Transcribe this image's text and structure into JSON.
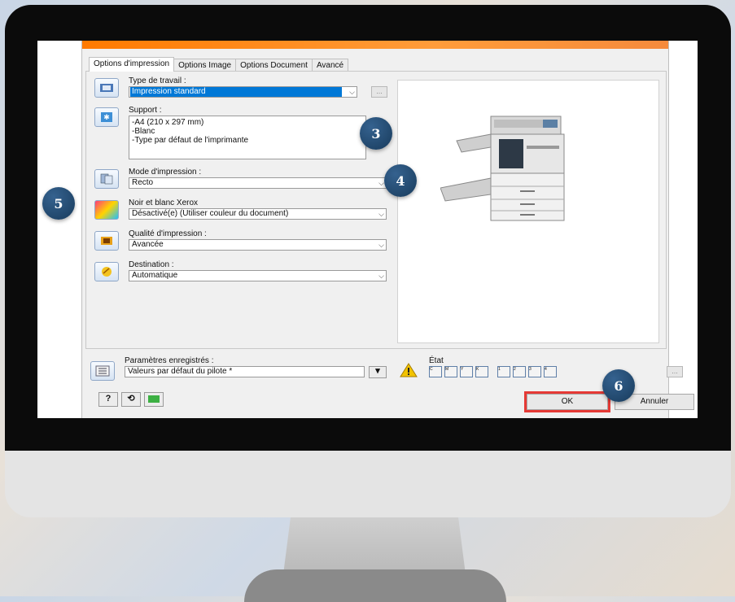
{
  "tabs": [
    "Options d'impression",
    "Options Image",
    "Options Document",
    "Avancé"
  ],
  "type_travail": {
    "label": "Type de travail :",
    "value": "Impression standard"
  },
  "support": {
    "label": "Support :",
    "lines": [
      "-A4 (210 x 297 mm)",
      "-Blanc",
      "-Type par défaut de l'imprimante"
    ]
  },
  "mode": {
    "label": "Mode d'impression :",
    "value": "Recto"
  },
  "noir_blanc": {
    "label": "Noir et blanc Xerox",
    "value": "Désactivé(e) (Utiliser couleur du document)"
  },
  "qualite": {
    "label": "Qualité d'impression :",
    "value": "Avancée"
  },
  "destination": {
    "label": "Destination :",
    "value": "Automatique"
  },
  "params": {
    "label": "Paramètres enregistrés :",
    "value": "Valeurs par défaut du pilote *"
  },
  "etat": {
    "label": "État :",
    "cells": [
      "C",
      "M",
      "Y",
      "K",
      "1",
      "2",
      "3",
      "4"
    ]
  },
  "buttons": {
    "ok": "OK",
    "cancel": "Annuler",
    "help": "?",
    "dots": "..."
  },
  "badges": {
    "b3": "3",
    "b4": "4",
    "b5": "5",
    "b6": "6"
  },
  "colors": {
    "accent_orange": "#ff7a00",
    "badge_blue": "#1e4a73",
    "highlight_red": "#e53935",
    "selection_blue": "#0078d7"
  },
  "icons": [
    "job-type-icon",
    "support-icon",
    "print-mode-icon",
    "color-icon",
    "quality-icon",
    "destination-icon",
    "saved-settings-icon",
    "warning-icon",
    "printer-image"
  ]
}
